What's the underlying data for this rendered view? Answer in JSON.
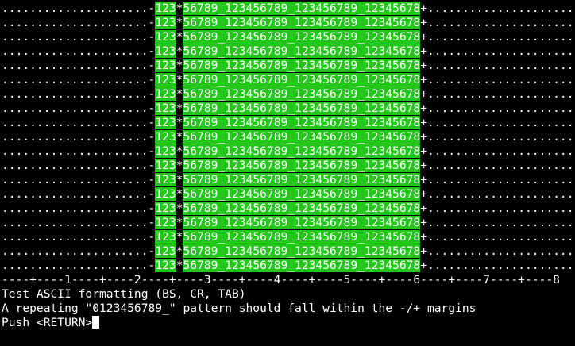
{
  "terminal": {
    "pattern_rows": {
      "count": 19,
      "left_margin": ".....................",
      "left_marker": "-",
      "highlight_a": "123",
      "star": "*",
      "highlight_b": "56789_123456789_123456789_12345678",
      "right_marker": "+",
      "right_margin": "....................."
    },
    "ruler": "----+----1----+----2----+----3----+----4----+----5----+----6----+----7----+----8",
    "messages": [
      "Test ASCII formatting (BS, CR, TAB)",
      "A repeating \"0123456789_\" pattern should fall within the -/+ margins"
    ],
    "prompt": "Push <RETURN>"
  },
  "colors": {
    "background": "#000000",
    "text": "#ffffff",
    "highlight": "#22c71a",
    "cursor": "#ffffff"
  }
}
